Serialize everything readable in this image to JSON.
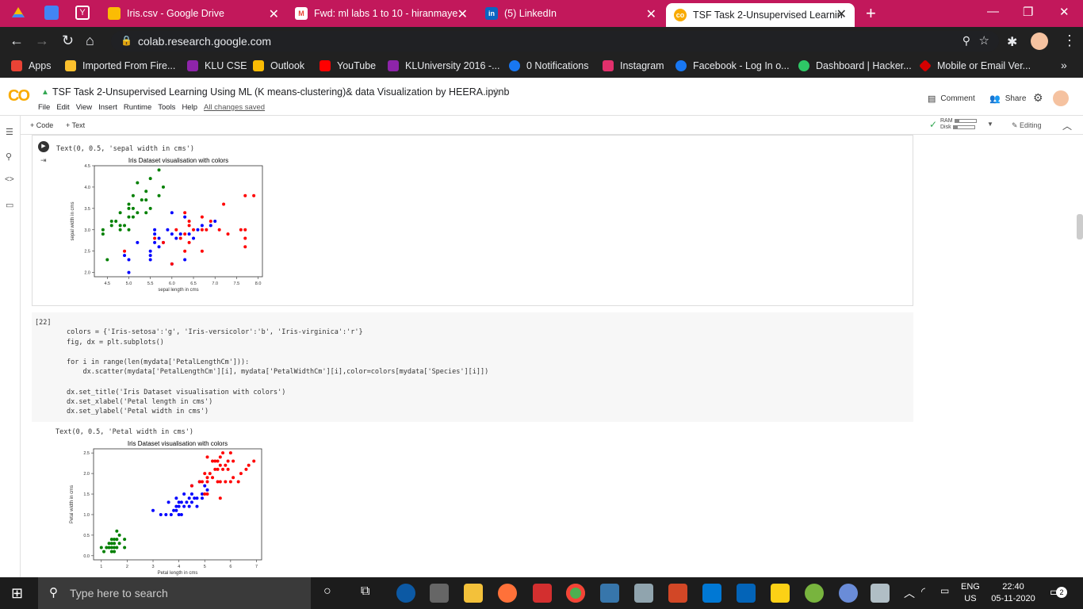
{
  "tabs": [
    {
      "label": "Iris.csv - Google Drive",
      "active": false
    },
    {
      "label": "Fwd: ml labs 1 to 10 - hiranmaye",
      "active": false
    },
    {
      "label": "(5) LinkedIn",
      "active": false
    },
    {
      "label": "TSF Task 2-Unsupervised Learnin",
      "active": true
    }
  ],
  "address": {
    "url": "colab.research.google.com"
  },
  "bookmarks": [
    {
      "label": "Apps",
      "color": "#ea4335"
    },
    {
      "label": "Imported From Fire...",
      "color": "#fbc02d"
    },
    {
      "label": "KLU CSE",
      "color": "#8e24aa"
    },
    {
      "label": "Outlook",
      "color": "#fbbc04"
    },
    {
      "label": "YouTube",
      "color": "#ff0000"
    },
    {
      "label": "KLUniversity 2016 -...",
      "color": "#8e24aa"
    },
    {
      "label": "0 Notifications",
      "color": "#1877f2"
    },
    {
      "label": "Instagram",
      "color": "#e1306c"
    },
    {
      "label": "Facebook - Log In o...",
      "color": "#1877f2"
    },
    {
      "label": "Dashboard | Hacker...",
      "color": "#2ec866"
    },
    {
      "label": "Mobile or Email Ver...",
      "color": "#d50000"
    }
  ],
  "bookmarks_overflow": "»",
  "notebook": {
    "title": "TSF Task 2-Unsupervised Learning Using ML (K means-clustering)& data Visualization by HEERA.ipynb",
    "menus": [
      "File",
      "Edit",
      "View",
      "Insert",
      "Runtime",
      "Tools",
      "Help"
    ],
    "saved_status": "All changes saved",
    "comment_label": "Comment",
    "share_label": "Share",
    "add_code": "+ Code",
    "add_text": "+ Text",
    "ram_label": "RAM",
    "disk_label": "Disk",
    "editing_label": "Editing"
  },
  "cells": {
    "out1_text": "Text(0, 0.5, 'sepal width in cms')",
    "cell2_exec": "[22]",
    "cell2_lines": [
      "colors = {'Iris-setosa':'g', 'Iris-versicolor':'b', 'Iris-virginica':'r'}",
      "fig, dx = plt.subplots()",
      "",
      "for i in range(len(mydata['PetalLengthCm'])):",
      "    dx.scatter(mydata['PetalLengthCm'][i], mydata['PetalWidthCm'][i],color=colors[mydata['Species'][i]])",
      "",
      "dx.set_title('Iris Dataset visualisation with colors')",
      "dx.set_xlabel('Petal length in cms')",
      "dx.set_ylabel('Petal width in cms')"
    ],
    "out2_text": "Text(0, 0.5, 'Petal width in cms')"
  },
  "chart_data": [
    {
      "type": "scatter",
      "title": "Iris Dataset visualisation with colors",
      "xlabel": "sepal length in cms",
      "ylabel": "sepal width in cms",
      "xlim": [
        4.2,
        8.1
      ],
      "ylim": [
        1.9,
        4.5
      ],
      "xticks": [
        "4.5",
        "5.0",
        "5.5",
        "6.0",
        "6.5",
        "7.0",
        "7.5",
        "8.0"
      ],
      "yticks": [
        "2.0",
        "2.5",
        "3.0",
        "3.5",
        "4.0",
        "4.5"
      ],
      "series": [
        {
          "color": "#008000",
          "points": [
            [
              4.4,
              2.9
            ],
            [
              4.4,
              3.0
            ],
            [
              4.5,
              2.3
            ],
            [
              4.6,
              3.1
            ],
            [
              4.6,
              3.2
            ],
            [
              4.7,
              3.2
            ],
            [
              4.8,
              3.0
            ],
            [
              4.8,
              3.4
            ],
            [
              4.9,
              3.1
            ],
            [
              5.0,
              3.0
            ],
            [
              5.0,
              3.3
            ],
            [
              5.0,
              3.5
            ],
            [
              5.1,
              3.5
            ],
            [
              5.1,
              3.8
            ],
            [
              5.2,
              3.4
            ],
            [
              5.3,
              3.7
            ],
            [
              5.4,
              3.4
            ],
            [
              5.4,
              3.9
            ],
            [
              5.5,
              3.5
            ],
            [
              5.7,
              3.8
            ],
            [
              5.7,
              4.4
            ],
            [
              5.8,
              4.0
            ],
            [
              5.2,
              4.1
            ],
            [
              5.5,
              4.2
            ],
            [
              4.8,
              3.1
            ],
            [
              5.0,
              3.6
            ],
            [
              5.1,
              3.3
            ],
            [
              5.4,
              3.7
            ]
          ]
        },
        {
          "color": "#0000ff",
          "points": [
            [
              4.9,
              2.4
            ],
            [
              5.0,
              2.0
            ],
            [
              5.0,
              2.3
            ],
            [
              5.5,
              2.3
            ],
            [
              5.5,
              2.4
            ],
            [
              5.5,
              2.5
            ],
            [
              5.6,
              2.7
            ],
            [
              5.6,
              3.0
            ],
            [
              5.7,
              2.6
            ],
            [
              5.7,
              2.8
            ],
            [
              5.8,
              2.7
            ],
            [
              5.9,
              3.0
            ],
            [
              6.0,
              2.2
            ],
            [
              6.0,
              2.9
            ],
            [
              6.0,
              3.4
            ],
            [
              6.1,
              2.8
            ],
            [
              6.2,
              2.9
            ],
            [
              6.3,
              2.3
            ],
            [
              6.3,
              3.3
            ],
            [
              6.4,
              2.9
            ],
            [
              6.6,
              3.0
            ],
            [
              6.7,
              3.1
            ],
            [
              6.9,
              3.1
            ],
            [
              7.0,
              3.2
            ],
            [
              5.2,
              2.7
            ],
            [
              5.6,
              2.9
            ],
            [
              6.5,
              2.8
            ]
          ]
        },
        {
          "color": "#ff0000",
          "points": [
            [
              4.9,
              2.5
            ],
            [
              5.6,
              2.8
            ],
            [
              5.8,
              2.7
            ],
            [
              6.0,
              2.2
            ],
            [
              6.1,
              3.0
            ],
            [
              6.2,
              2.8
            ],
            [
              6.3,
              2.5
            ],
            [
              6.3,
              2.9
            ],
            [
              6.4,
              2.7
            ],
            [
              6.4,
              3.2
            ],
            [
              6.5,
              3.0
            ],
            [
              6.7,
              2.5
            ],
            [
              6.7,
              3.3
            ],
            [
              6.8,
              3.0
            ],
            [
              6.9,
              3.2
            ],
            [
              7.1,
              3.0
            ],
            [
              7.2,
              3.6
            ],
            [
              7.3,
              2.9
            ],
            [
              7.6,
              3.0
            ],
            [
              7.7,
              2.6
            ],
            [
              7.7,
              2.8
            ],
            [
              7.7,
              3.8
            ],
            [
              7.9,
              3.8
            ],
            [
              7.7,
              3.0
            ],
            [
              6.3,
              3.4
            ],
            [
              6.4,
              3.1
            ],
            [
              6.7,
              3.0
            ]
          ]
        }
      ]
    },
    {
      "type": "scatter",
      "title": "Iris Dataset visualisation with colors",
      "xlabel": "Petal length in cms",
      "ylabel": "Petal width in cms",
      "xlim": [
        0.7,
        7.2
      ],
      "ylim": [
        -0.1,
        2.6
      ],
      "xticks": [
        "1",
        "2",
        "3",
        "4",
        "5",
        "6",
        "7"
      ],
      "yticks": [
        "0.0",
        "0.5",
        "1.0",
        "1.5",
        "2.0",
        "2.5"
      ],
      "series": [
        {
          "color": "#008000",
          "points": [
            [
              1.0,
              0.2
            ],
            [
              1.1,
              0.1
            ],
            [
              1.2,
              0.2
            ],
            [
              1.3,
              0.2
            ],
            [
              1.3,
              0.3
            ],
            [
              1.4,
              0.1
            ],
            [
              1.4,
              0.2
            ],
            [
              1.4,
              0.3
            ],
            [
              1.5,
              0.1
            ],
            [
              1.5,
              0.2
            ],
            [
              1.5,
              0.4
            ],
            [
              1.6,
              0.2
            ],
            [
              1.6,
              0.6
            ],
            [
              1.7,
              0.3
            ],
            [
              1.7,
              0.5
            ],
            [
              1.9,
              0.2
            ],
            [
              1.9,
              0.4
            ],
            [
              1.4,
              0.4
            ],
            [
              1.6,
              0.4
            ],
            [
              1.5,
              0.3
            ]
          ]
        },
        {
          "color": "#0000ff",
          "points": [
            [
              3.0,
              1.1
            ],
            [
              3.3,
              1.0
            ],
            [
              3.5,
              1.0
            ],
            [
              3.6,
              1.3
            ],
            [
              3.7,
              1.0
            ],
            [
              3.8,
              1.1
            ],
            [
              3.9,
              1.1
            ],
            [
              3.9,
              1.2
            ],
            [
              3.9,
              1.4
            ],
            [
              4.0,
              1.0
            ],
            [
              4.0,
              1.2
            ],
            [
              4.0,
              1.3
            ],
            [
              4.1,
              1.0
            ],
            [
              4.1,
              1.3
            ],
            [
              4.2,
              1.2
            ],
            [
              4.2,
              1.5
            ],
            [
              4.3,
              1.3
            ],
            [
              4.4,
              1.2
            ],
            [
              4.4,
              1.4
            ],
            [
              4.5,
              1.3
            ],
            [
              4.5,
              1.5
            ],
            [
              4.6,
              1.4
            ],
            [
              4.7,
              1.2
            ],
            [
              4.7,
              1.4
            ],
            [
              4.8,
              1.8
            ],
            [
              4.9,
              1.5
            ],
            [
              5.0,
              1.7
            ],
            [
              5.1,
              1.6
            ],
            [
              4.5,
              1.7
            ],
            [
              4.9,
              1.4
            ]
          ]
        },
        {
          "color": "#ff0000",
          "points": [
            [
              4.5,
              1.7
            ],
            [
              4.8,
              1.8
            ],
            [
              4.9,
              1.8
            ],
            [
              5.0,
              1.5
            ],
            [
              5.0,
              2.0
            ],
            [
              5.1,
              1.5
            ],
            [
              5.1,
              1.9
            ],
            [
              5.1,
              2.4
            ],
            [
              5.2,
              2.0
            ],
            [
              5.3,
              1.9
            ],
            [
              5.4,
              2.3
            ],
            [
              5.5,
              1.8
            ],
            [
              5.5,
              2.1
            ],
            [
              5.6,
              1.4
            ],
            [
              5.6,
              2.2
            ],
            [
              5.6,
              2.4
            ],
            [
              5.7,
              2.1
            ],
            [
              5.7,
              2.5
            ],
            [
              5.8,
              1.8
            ],
            [
              5.8,
              2.2
            ],
            [
              5.9,
              2.3
            ],
            [
              6.0,
              1.8
            ],
            [
              6.0,
              2.5
            ],
            [
              6.1,
              1.9
            ],
            [
              6.1,
              2.3
            ],
            [
              6.3,
              1.8
            ],
            [
              6.4,
              2.0
            ],
            [
              6.6,
              2.1
            ],
            [
              6.7,
              2.2
            ],
            [
              6.9,
              2.3
            ],
            [
              5.3,
              2.3
            ],
            [
              5.5,
              2.3
            ],
            [
              5.9,
              2.1
            ],
            [
              5.4,
              2.1
            ],
            [
              5.1,
              1.8
            ],
            [
              5.6,
              1.8
            ]
          ]
        }
      ]
    }
  ],
  "taskbar": {
    "search_placeholder": "Type here to search",
    "lang": "ENG",
    "region": "US",
    "time": "22:40",
    "date": "05-11-2020",
    "notif_count": "2"
  }
}
